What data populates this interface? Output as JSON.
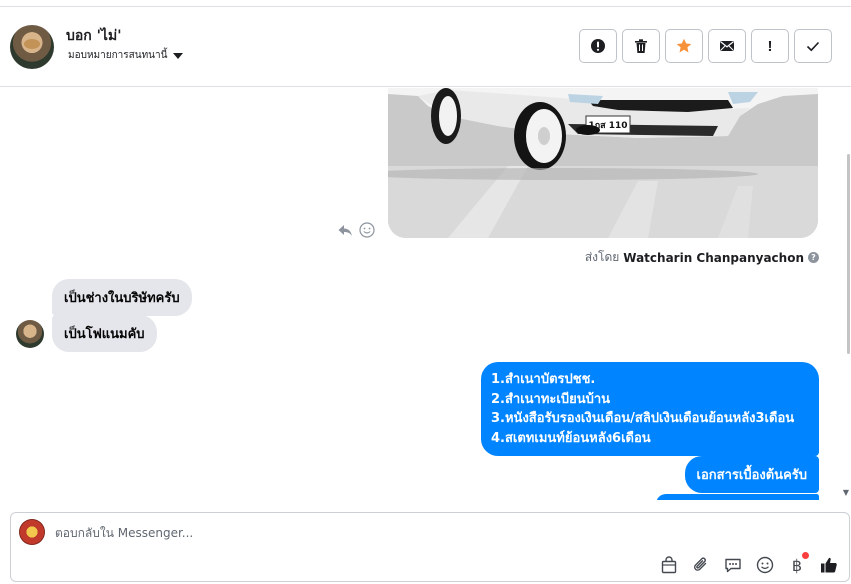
{
  "header": {
    "contact_name": "บอก 'ไม่'",
    "assign_label": "มอบหมายการสนทนานี้",
    "actions": [
      {
        "name": "mark-spam",
        "icon": "alert-circle-icon"
      },
      {
        "name": "delete",
        "icon": "trash-icon"
      },
      {
        "name": "star",
        "icon": "star-icon"
      },
      {
        "name": "mark-unread",
        "icon": "envelope-icon"
      },
      {
        "name": "follow-up",
        "icon": "exclamation-icon",
        "glyph": "!"
      },
      {
        "name": "mark-done",
        "icon": "check-icon"
      }
    ],
    "colors": {
      "star": "#f7923b",
      "border": "#bec3c9"
    }
  },
  "chat": {
    "photo_plate": "1กส 110",
    "sent_by_prefix": "ส่งโดย",
    "sent_by_name": "Watcharin Chanpanyachon",
    "incoming": [
      "เป็นช่างในบริษัทครับ",
      "เป็นโฟแนมคับ"
    ],
    "outgoing_list": [
      "1.สำเนาบัตรปชช.",
      "2.สำเนาทะเบียนบ้าน",
      "3.หนังสือรับรองเงินเดือน/สลิปเงินเดือนย้อนหลัง3เดือน",
      "4.สเตทเมนท์ย้อนหลัง6เดือน"
    ],
    "outgoing_2": "เอกสารเบื้องต้นครับ",
    "colors": {
      "outgoing": "#0084ff",
      "incoming": "#e4e6eb"
    }
  },
  "composer": {
    "placeholder": "ตอบกลับใน Messenger...",
    "tools": [
      "bag-icon",
      "paperclip-icon",
      "saved-replies-icon",
      "emoji-icon",
      "baht-icon",
      "thumbs-up-icon"
    ],
    "baht_symbol": "฿"
  }
}
